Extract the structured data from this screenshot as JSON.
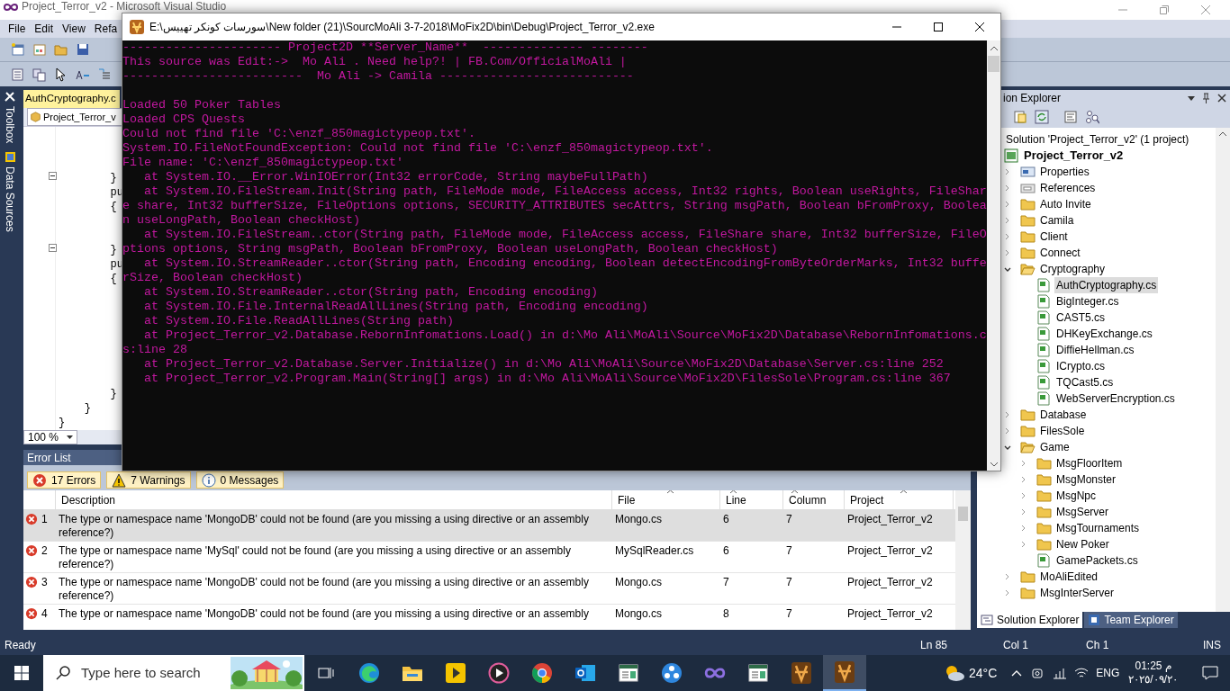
{
  "vs_window": {
    "title": "Project_Terror_v2 - Microsoft Visual Studio",
    "menu": [
      "File",
      "Edit",
      "View",
      "Refa"
    ]
  },
  "side_tabs": [
    "Toolbox",
    "Data Sources"
  ],
  "editor": {
    "tab": "AuthCryptography.c",
    "type_dropdown": "Project_Terror_v",
    "code_blocks": [
      [
        "        }",
        "        pu",
        "        {"
      ],
      [
        "        }",
        "        pu",
        "        {"
      ],
      [
        "        }",
        "    }",
        "}"
      ]
    ],
    "zoom": "100 %"
  },
  "error_list": {
    "title": "Error List",
    "filters": [
      {
        "kind": "error",
        "label": "17 Errors",
        "on": true
      },
      {
        "kind": "warning",
        "label": "7 Warnings",
        "on": true
      },
      {
        "kind": "message",
        "label": "0 Messages",
        "on": true
      }
    ],
    "columns": [
      "Description",
      "File",
      "Line",
      "Column",
      "Project"
    ],
    "rows": [
      {
        "number": "1",
        "description": "The type or namespace name 'MongoDB' could not be found (are you missing a using directive or an assembly reference?)",
        "file": "Mongo.cs",
        "line": "6",
        "column": "7",
        "project": "Project_Terror_v2",
        "selected": true
      },
      {
        "number": "2",
        "description": "The type or namespace name 'MySql' could not be found (are you missing a using directive or an assembly reference?)",
        "file": "MySqlReader.cs",
        "line": "6",
        "column": "7",
        "project": "Project_Terror_v2",
        "selected": false
      },
      {
        "number": "3",
        "description": "The type or namespace name 'MongoDB' could not be found (are you missing a using directive or an assembly reference?)",
        "file": "Mongo.cs",
        "line": "7",
        "column": "7",
        "project": "Project_Terror_v2",
        "selected": false
      },
      {
        "number": "4",
        "description": "The type or namespace name 'MongoDB' could not be found (are you missing a using directive or an assembly",
        "file": "Mongo.cs",
        "line": "8",
        "column": "7",
        "project": "Project_Terror_v2",
        "selected": false
      }
    ]
  },
  "solution_explorer": {
    "title": "ion Explorer",
    "tree": [
      {
        "label": "Solution 'Project_Terror_v2' (1 project)",
        "selected": false,
        "children": [
          {
            "label": "Project_Terror_v2",
            "kind": "project",
            "selected": false,
            "children": [
              {
                "label": "Properties",
                "kind": "properties",
                "selected": false,
                "expanded": false
              },
              {
                "label": "References",
                "kind": "references",
                "selected": false,
                "expanded": false
              },
              {
                "label": "Auto Invite",
                "kind": "folder",
                "selected": false,
                "expanded": false
              },
              {
                "label": "Camila",
                "kind": "folder",
                "selected": false,
                "expanded": false
              },
              {
                "label": "Client",
                "kind": "folder",
                "selected": false,
                "expanded": false
              },
              {
                "label": "Connect",
                "kind": "folder",
                "selected": false,
                "expanded": false
              },
              {
                "label": "Cryptography",
                "kind": "folder",
                "selected": false,
                "expanded": true,
                "children": [
                  {
                    "label": "AuthCryptography.cs",
                    "kind": "file",
                    "selected": true
                  },
                  {
                    "label": "BigInteger.cs",
                    "kind": "file",
                    "selected": false
                  },
                  {
                    "label": "CAST5.cs",
                    "kind": "file",
                    "selected": false
                  },
                  {
                    "label": "DHKeyExchange.cs",
                    "kind": "file",
                    "selected": false
                  },
                  {
                    "label": "DiffieHellman.cs",
                    "kind": "file",
                    "selected": false
                  },
                  {
                    "label": "ICrypto.cs",
                    "kind": "file",
                    "selected": false
                  },
                  {
                    "label": "TQCast5.cs",
                    "kind": "file",
                    "selected": false
                  },
                  {
                    "label": "WebServerEncryption.cs",
                    "kind": "file",
                    "selected": false
                  }
                ]
              },
              {
                "label": "Database",
                "kind": "folder",
                "selected": false,
                "expanded": false
              },
              {
                "label": "FilesSole",
                "kind": "folder",
                "selected": false,
                "expanded": false
              },
              {
                "label": "Game",
                "kind": "folder",
                "selected": false,
                "expanded": true,
                "children": [
                  {
                    "label": "MsgFloorItem",
                    "kind": "folder",
                    "selected": false,
                    "expanded": false
                  },
                  {
                    "label": "MsgMonster",
                    "kind": "folder",
                    "selected": false,
                    "expanded": false
                  },
                  {
                    "label": "MsgNpc",
                    "kind": "folder",
                    "selected": false,
                    "expanded": false
                  },
                  {
                    "label": "MsgServer",
                    "kind": "folder",
                    "selected": false,
                    "expanded": false
                  },
                  {
                    "label": "MsgTournaments",
                    "kind": "folder",
                    "selected": false,
                    "expanded": false
                  },
                  {
                    "label": "New Poker",
                    "kind": "folder",
                    "selected": false,
                    "expanded": false
                  },
                  {
                    "label": "GamePackets.cs",
                    "kind": "file",
                    "selected": false
                  }
                ]
              },
              {
                "label": "MoAliEdited",
                "kind": "folder",
                "selected": false,
                "expanded": false
              },
              {
                "label": "MsgInterServer",
                "kind": "folder",
                "selected": false,
                "expanded": false
              }
            ]
          }
        ]
      }
    ],
    "tabs": [
      {
        "label": "Solution Explorer",
        "selected": true
      },
      {
        "label": "Team Explorer",
        "selected": false
      }
    ]
  },
  "console_window": {
    "title": "E:\\سورسات كونكر تهييس\\New folder (21)\\SourcMoAli 3-7-2018\\MoFix2D\\bin\\Debug\\Project_Terror_v2.exe",
    "header_lines": [
      "---------------------- Project2D **Server_Name**  -------------- --------",
      "This source was Edit:->  Mo Ali . Need help?! | FB.Com/OfficialMoAli |",
      "-------------------------  Mo Ali -> Camila ---------------------------"
    ],
    "log_lines": [
      "Loaded 50 Poker Tables",
      "Loaded CPS Quests",
      "Could not find file 'C:\\enzf_850magictypeop.txt'.",
      "System.IO.FileNotFoundException: Could not find file 'C:\\enzf_850magictypeop.txt'.",
      "File name: 'C:\\enzf_850magictypeop.txt'",
      "   at System.IO.__Error.WinIOError(Int32 errorCode, String maybeFullPath)",
      "   at System.IO.FileStream.Init(String path, FileMode mode, FileAccess access, Int32 rights, Boolean useRights, FileShar",
      "e share, Int32 bufferSize, FileOptions options, SECURITY_ATTRIBUTES secAttrs, String msgPath, Boolean bFromProxy, Boolea",
      "n useLongPath, Boolean checkHost)",
      "   at System.IO.FileStream..ctor(String path, FileMode mode, FileAccess access, FileShare share, Int32 bufferSize, FileO",
      "ptions options, String msgPath, Boolean bFromProxy, Boolean useLongPath, Boolean checkHost)",
      "   at System.IO.StreamReader..ctor(String path, Encoding encoding, Boolean detectEncodingFromByteOrderMarks, Int32 buffe",
      "rSize, Boolean checkHost)",
      "   at System.IO.StreamReader..ctor(String path, Encoding encoding)",
      "   at System.IO.File.InternalReadAllLines(String path, Encoding encoding)",
      "   at System.IO.File.ReadAllLines(String path)",
      "   at Project_Terror_v2.Database.RebornInfomations.Load() in d:\\Mo Ali\\MoAli\\Source\\MoFix2D\\Database\\RebornInfomations.c",
      "s:line 28",
      "   at Project_Terror_v2.Database.Server.Initialize() in d:\\Mo Ali\\MoAli\\Source\\MoFix2D\\Database\\Server.cs:line 252",
      "   at Project_Terror_v2.Program.Main(String[] args) in d:\\Mo Ali\\MoAli\\Source\\MoFix2D\\FilesSole\\Program.cs:line 367"
    ]
  },
  "status_bar": {
    "text": "Ready",
    "ln": "Ln 85",
    "col": "Col 1",
    "ch": "Ch 1",
    "mode": "INS"
  },
  "taskbar": {
    "search_placeholder": "Type here to search",
    "weather": "24°C",
    "language": "ENG",
    "time": "01:25 م",
    "date": "٢٠٢٥/٠٩/٢٠"
  }
}
